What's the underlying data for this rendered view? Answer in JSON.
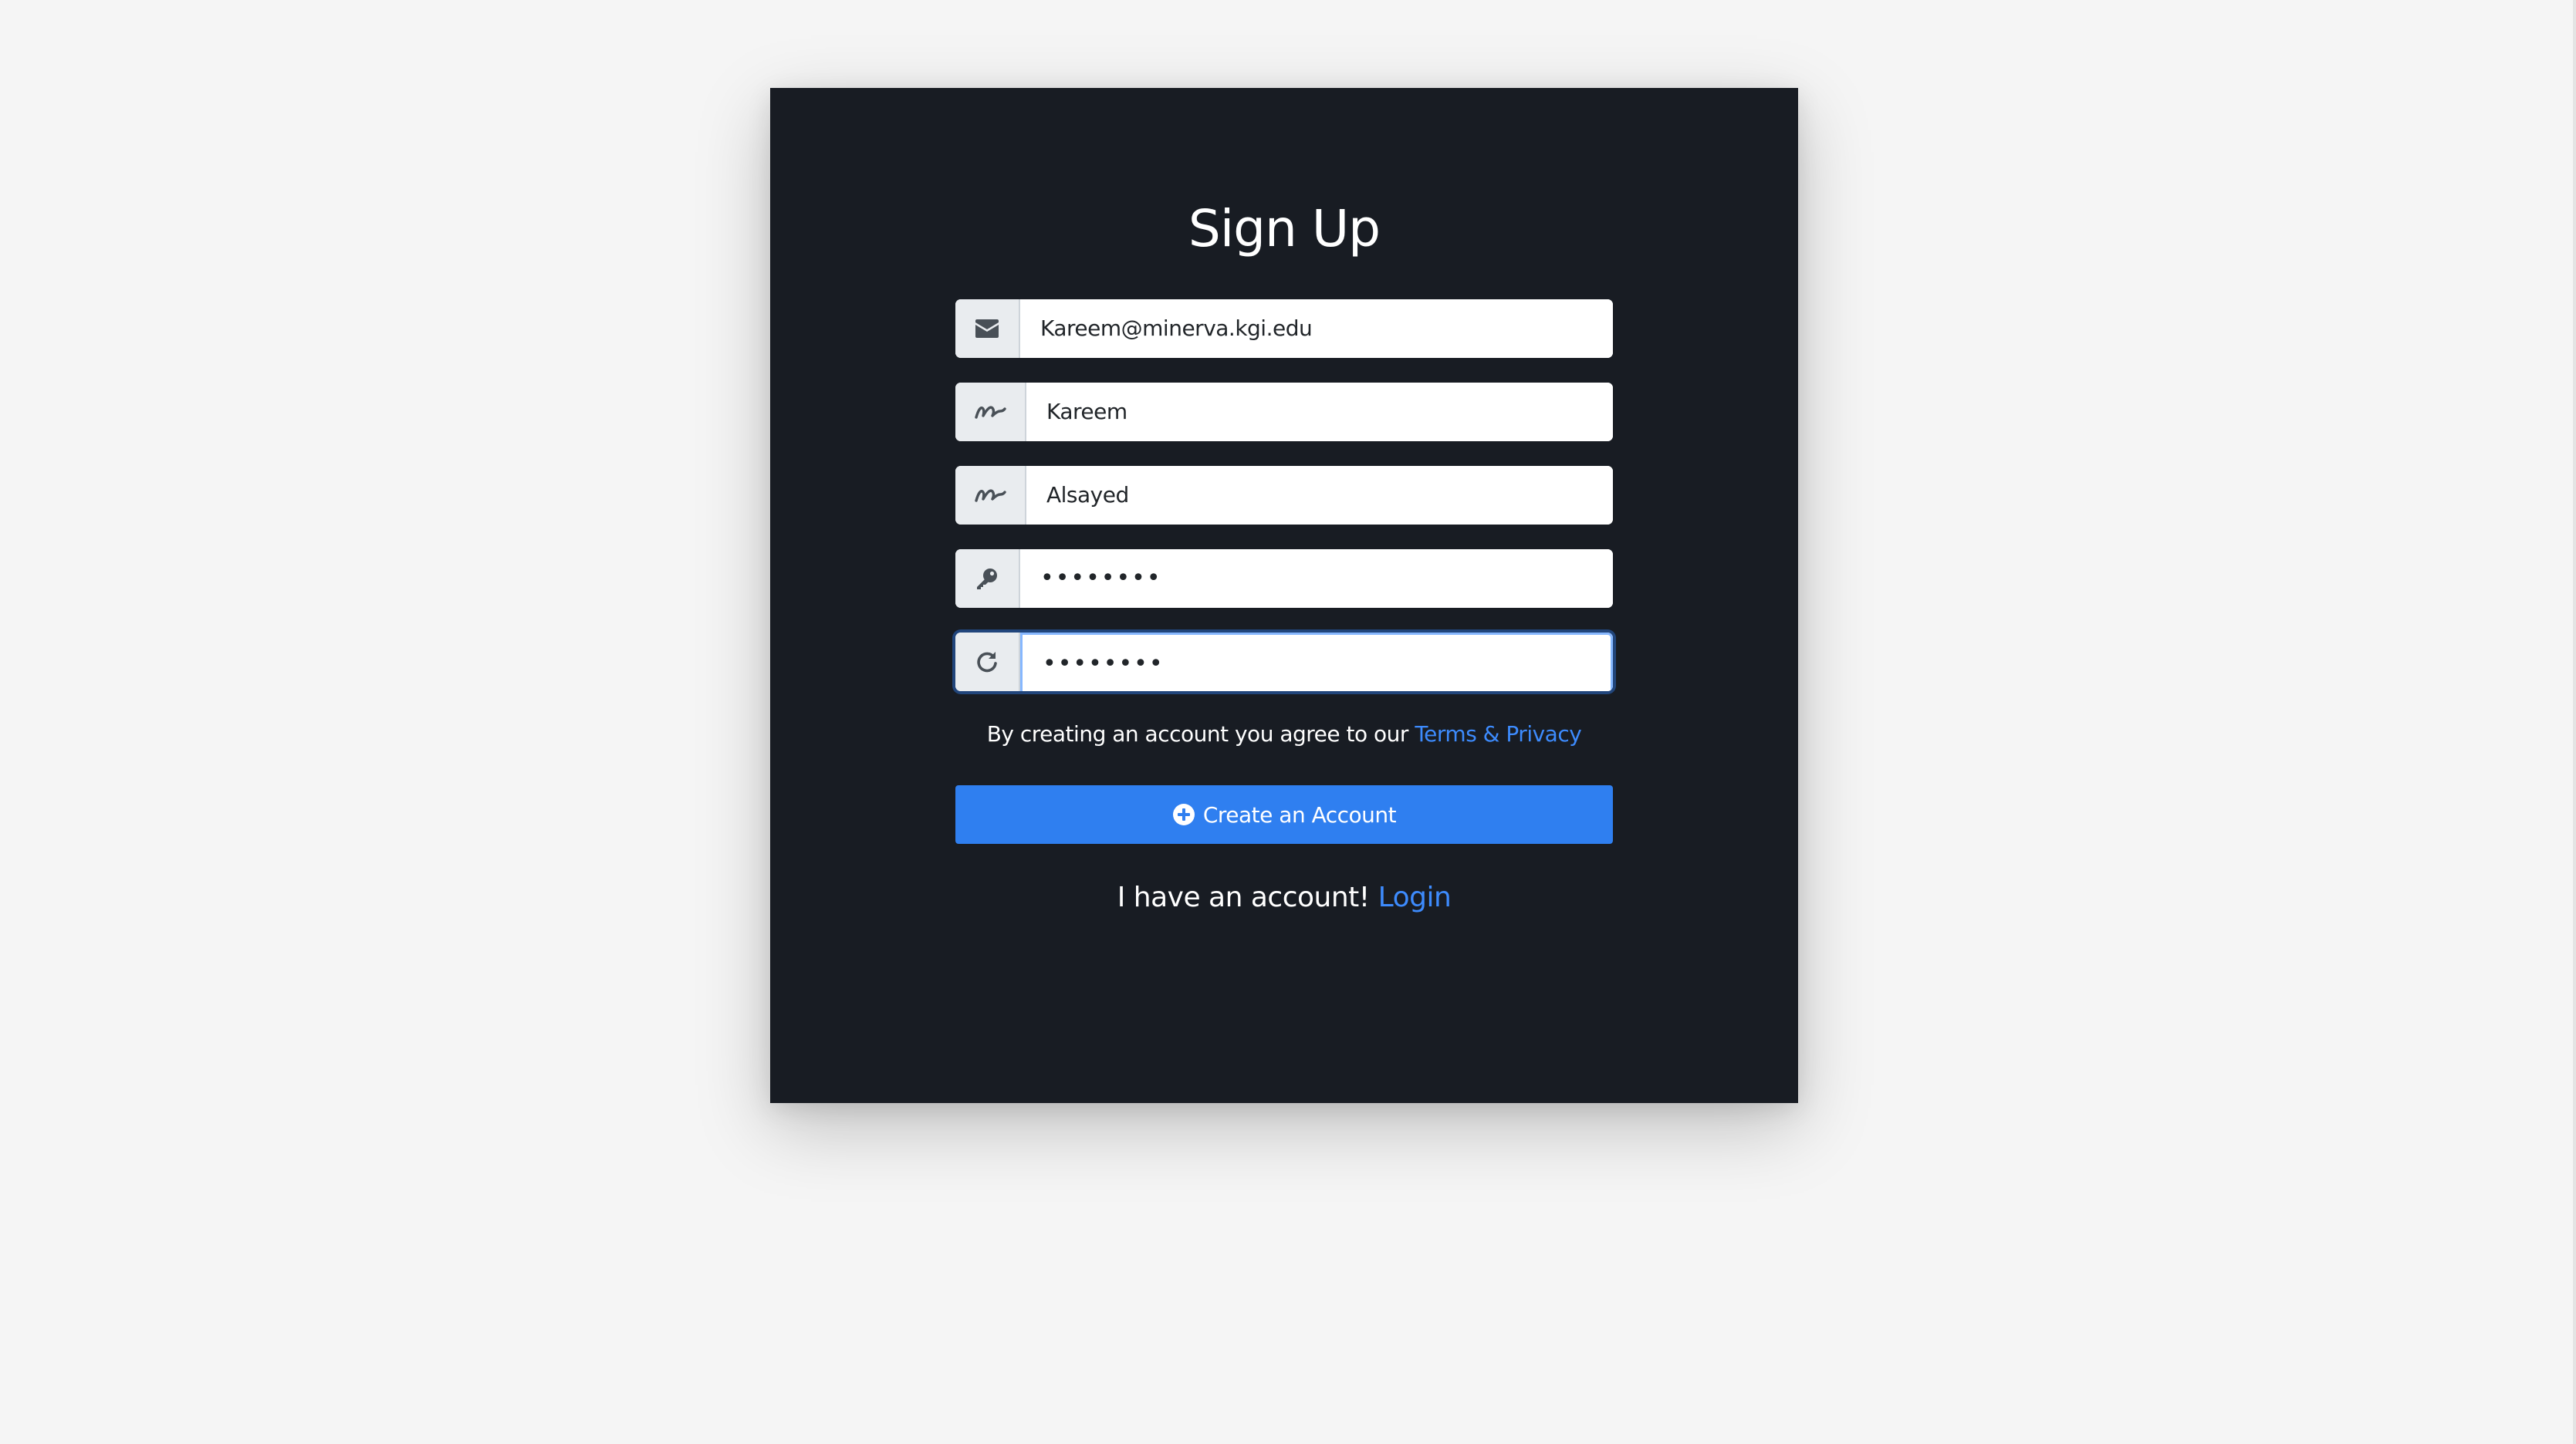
{
  "page": {
    "title": "Sign Up"
  },
  "form": {
    "email": {
      "value": "Kareem@minerva.kgi.edu",
      "icon": "envelope-icon"
    },
    "first_name": {
      "value": "Kareem",
      "icon": "signature-icon"
    },
    "last_name": {
      "value": "Alsayed",
      "icon": "signature-icon"
    },
    "password": {
      "value": "••••••••",
      "icon": "key-icon"
    },
    "confirm_password": {
      "value": "••••••••",
      "icon": "redo-icon"
    }
  },
  "terms": {
    "text": "By creating an account you agree to our ",
    "link_label": "Terms & Privacy"
  },
  "create_button": {
    "label": "Create an Account",
    "icon": "plus-circle-icon"
  },
  "login": {
    "text": "I have an account! ",
    "link_label": "Login"
  },
  "colors": {
    "card_background": "#181c23",
    "page_background": "#f5f5f5",
    "accent": "#2f7ff0",
    "link": "#3d8bfd"
  }
}
